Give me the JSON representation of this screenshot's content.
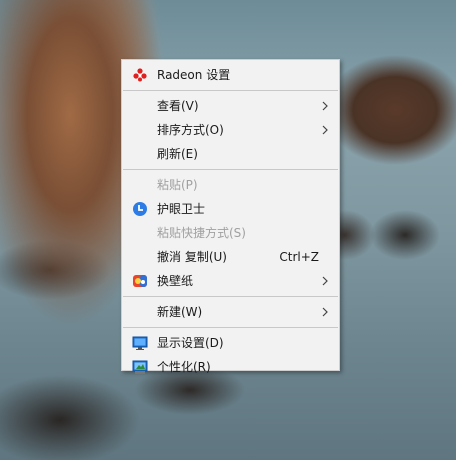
{
  "context_menu": {
    "items": [
      {
        "label": "Radeon 设置",
        "icon": "radeon-icon"
      },
      {
        "label": "查看(V)",
        "submenu": true
      },
      {
        "label": "排序方式(O)",
        "submenu": true
      },
      {
        "label": "刷新(E)"
      },
      {
        "label": "粘贴(P)",
        "disabled": true
      },
      {
        "label": "护眼卫士",
        "icon": "eye-care-icon"
      },
      {
        "label": "粘贴快捷方式(S)",
        "disabled": true
      },
      {
        "label": "撤消 复制(U)",
        "shortcut": "Ctrl+Z"
      },
      {
        "label": "换壁纸",
        "icon": "wallpaper-icon",
        "submenu": true
      },
      {
        "label": "新建(W)",
        "submenu": true
      },
      {
        "label": "显示设置(D)",
        "icon": "display-icon"
      },
      {
        "label": "个性化(R)",
        "icon": "personalize-icon"
      }
    ]
  },
  "colors": {
    "menu_bg": "#f2f2f2",
    "disabled_text": "#a0a0a0",
    "radeon_red": "#e0201f",
    "eye_care_blue": "#2d7be5"
  }
}
